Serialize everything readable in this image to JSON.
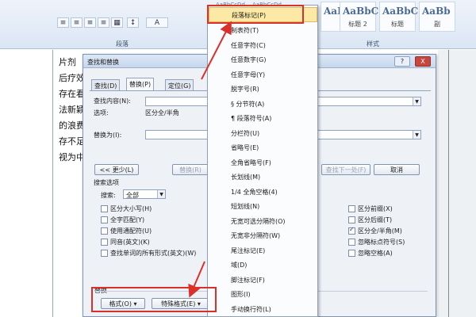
{
  "ribbon": {
    "paragraph_group": "段落",
    "styles_group": "样式",
    "style_preview_top": [
      "AaBbCcDd",
      "AaBbCcDd"
    ],
    "style_tiles": [
      {
        "sample": "AaBl",
        "name": ""
      },
      {
        "sample": "AaBbC",
        "name": "标题 2"
      },
      {
        "sample": "AaBbC",
        "name": "标题"
      },
      {
        "sample": "AaBb",
        "name": "副"
      }
    ],
    "format_buttons": [
      "≡",
      "≡",
      "≡",
      "≡",
      "▦",
      "↕",
      "A"
    ]
  },
  "document": {
    "lines": [
      "片剂",
      "后疗效",
      "存在看",
      "法新颖",
      "的浪费",
      "存不足",
      "视为中"
    ]
  },
  "dialog": {
    "title": "查找和替换",
    "title_buttons": {
      "help": "?",
      "close": "X"
    },
    "tabs": [
      "查找(D)",
      "替换(P)",
      "定位(G)"
    ],
    "find_label": "查找内容(N):",
    "options_label": "选项:",
    "options_value": "区分全/半角",
    "replace_label": "替换为(I):",
    "less_button": "<< 更少(L)",
    "replace_button": "替换(R)",
    "find_next_button": "查找下一处(F)",
    "cancel_button": "取消",
    "search_options_label": "搜索选项",
    "search_label": "搜索:",
    "search_value": "全部",
    "left_checkboxes": [
      {
        "label": "区分大小写(H)",
        "checked": false
      },
      {
        "label": "全字匹配(Y)",
        "checked": false
      },
      {
        "label": "使用通配符(U)",
        "checked": false
      },
      {
        "label": "同音(英文)(K)",
        "checked": false
      },
      {
        "label": "查找单词的所有形式(英文)(W)",
        "checked": false
      }
    ],
    "right_checkboxes": [
      {
        "label": "区分前缀(X)",
        "checked": false
      },
      {
        "label": "区分后缀(T)",
        "checked": false
      },
      {
        "label": "区分全/半角(M)",
        "checked": true
      },
      {
        "label": "忽略标点符号(S)",
        "checked": false
      },
      {
        "label": "忽略空格(A)",
        "checked": false
      }
    ],
    "replace_section_label": "替换",
    "format_button": "格式(O) ▾",
    "special_button": "特殊格式(E) ▾"
  },
  "menu": {
    "items": [
      "段落标记(P)",
      "制表符(T)",
      "任意字符(C)",
      "任意数字(G)",
      "任意字母(Y)",
      "脱字号(R)",
      "§ 分节符(A)",
      "¶ 段落符号(A)",
      "分栏符(U)",
      "省略号(E)",
      "全角省略号(F)",
      "长划线(M)",
      "1/4 全角空格(4)",
      "短划线(N)",
      "无宽可选分隔符(O)",
      "无宽非分隔符(W)",
      "尾注标记(E)",
      "域(D)",
      "脚注标记(F)",
      "图形(I)",
      "手动换行符(L)"
    ],
    "highlighted_index": 0
  },
  "colors": {
    "annotation_red": "#d9302a",
    "menu_highlight": "#fde9a6",
    "dialog_bg": "#eef1f6"
  }
}
